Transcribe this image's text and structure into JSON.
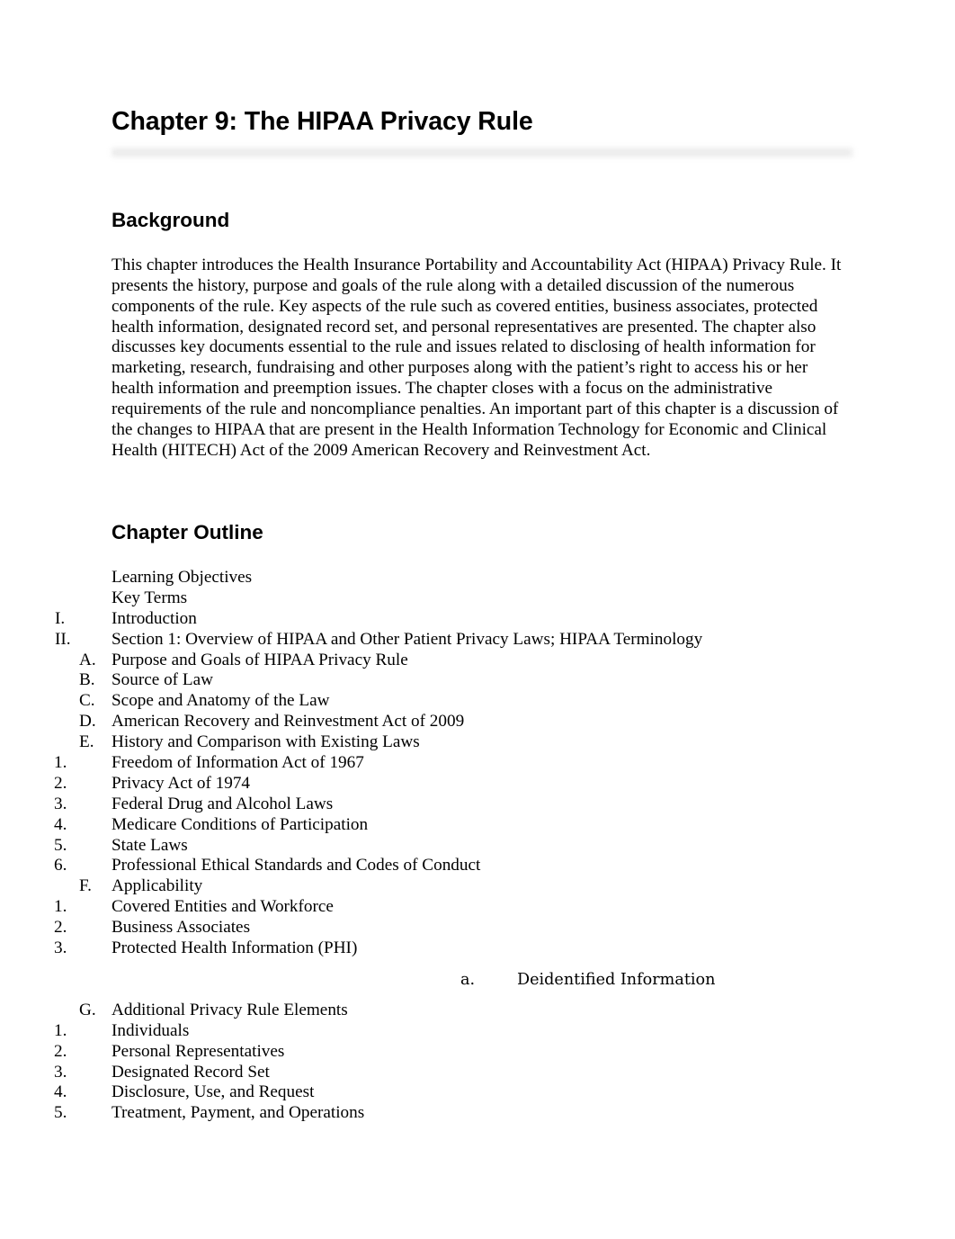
{
  "document": {
    "title": "Chapter 9: The HIPAA Privacy Rule"
  },
  "sections": {
    "background": {
      "heading": "Background",
      "paragraph": "This chapter introduces the Health Insurance Portability and Accountability Act (HIPAA) Privacy Rule. It presents the history, purpose and goals of the rule along with a detailed discussion of the numerous components of the rule. Key aspects of the rule such as covered entities, business associates, protected health information, designated record set, and personal representatives are presented. The chapter also discusses key documents essential to the rule and issues related to disclosing of health information for marketing, research, fundraising and other purposes along with the patient’s right to access his or her health information and preemption issues. The chapter closes with a focus on the administrative requirements of the rule and noncompliance penalties. An important part of this chapter is a discussion of the changes to HIPAA that are present in the Health Information Technology for Economic and Clinical Health (HITECH) Act of the 2009 American Recovery and Reinvestment Act."
    },
    "chapter_outline": {
      "heading": "Chapter Outline",
      "items": [
        {
          "marker": "",
          "text": "Learning Objectives",
          "level": "none"
        },
        {
          "marker": "",
          "text": "Key Terms",
          "level": "none"
        },
        {
          "marker": "I.",
          "text": "Introduction",
          "level": "roman"
        },
        {
          "marker": "II.",
          "text": "Section 1: Overview of HIPAA and Other Patient Privacy Laws; HIPAA Terminology",
          "level": "roman"
        },
        {
          "marker": "A.",
          "text": "Purpose and Goals of HIPAA Privacy Rule",
          "level": "letter"
        },
        {
          "marker": "B.",
          "text": "Source of Law",
          "level": "letter"
        },
        {
          "marker": "C.",
          "text": "Scope and Anatomy of the Law",
          "level": "letter"
        },
        {
          "marker": "D.",
          "text": "American Recovery and Reinvestment Act of 2009",
          "level": "letter"
        },
        {
          "marker": "E.",
          "text": "History and Comparison with Existing Laws",
          "level": "letter"
        },
        {
          "marker": "1.",
          "text": "Freedom of Information Act of 1967",
          "level": "number"
        },
        {
          "marker": "2.",
          "text": "Privacy Act of 1974",
          "level": "number"
        },
        {
          "marker": "3.",
          "text": "Federal Drug and Alcohol Laws",
          "level": "number"
        },
        {
          "marker": "4.",
          "text": "Medicare Conditions of Participation",
          "level": "number"
        },
        {
          "marker": "5.",
          "text": "State Laws",
          "level": "number"
        },
        {
          "marker": "6.",
          "text": "Professional Ethical Standards and Codes of Conduct",
          "level": "number"
        },
        {
          "marker": "F.",
          "text": "Applicability",
          "level": "letter"
        },
        {
          "marker": "1.",
          "text": "Covered Entities and Workforce",
          "level": "number"
        },
        {
          "marker": "2.",
          "text": "Business Associates",
          "level": "number"
        },
        {
          "marker": "3.",
          "text": "Protected Health Information (PHI)",
          "level": "number"
        },
        {
          "marker": "a.",
          "text": "Deidentified Information",
          "level": "alpha"
        },
        {
          "marker": "G.",
          "text": "Additional Privacy Rule Elements",
          "level": "letter"
        },
        {
          "marker": "1.",
          "text": "Individuals",
          "level": "number"
        },
        {
          "marker": "2.",
          "text": "Personal Representatives",
          "level": "number"
        },
        {
          "marker": "3.",
          "text": "Designated Record Set",
          "level": "number"
        },
        {
          "marker": "4.",
          "text": "Disclosure, Use, and Request",
          "level": "number"
        },
        {
          "marker": "5.",
          "text": "Treatment, Payment, and Operations",
          "level": "number"
        }
      ]
    }
  },
  "style": {
    "page_background": "#ffffff",
    "text_color": "#000000",
    "rule_color": "#f0f0f0"
  }
}
